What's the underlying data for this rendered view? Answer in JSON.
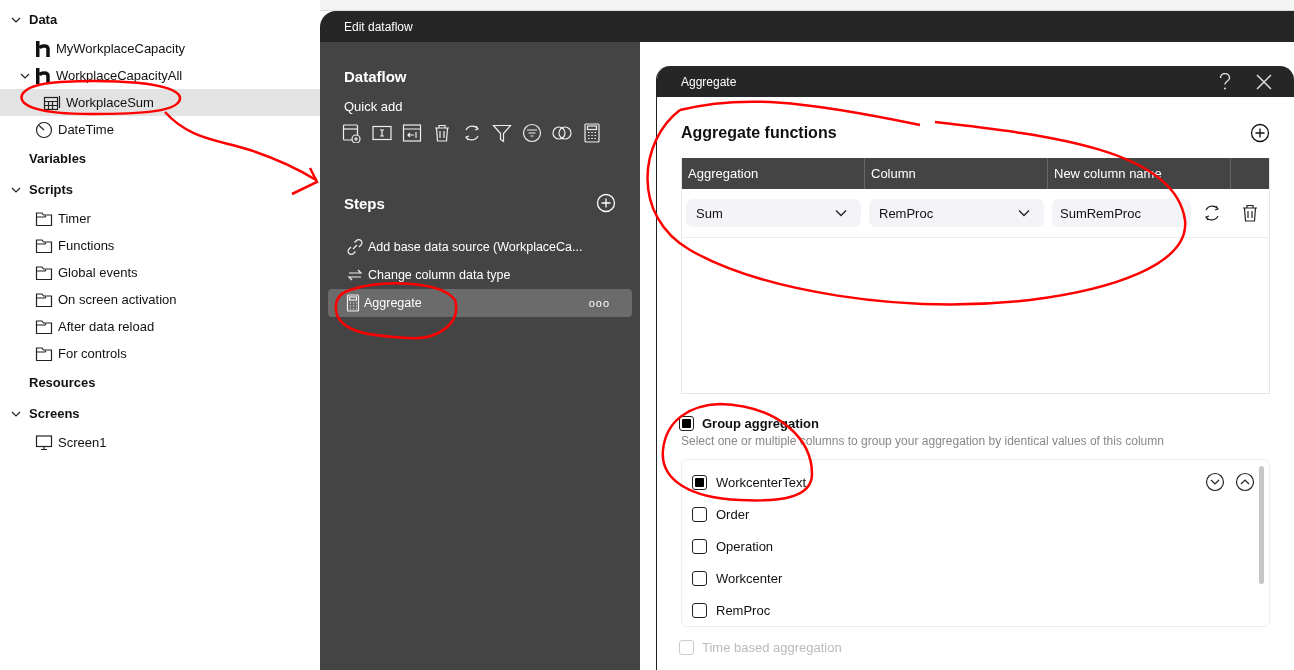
{
  "tree": [
    {
      "label": "Data",
      "expanded": true,
      "children": [
        {
          "label": "MyWorkplaceCapacity",
          "kind": "source",
          "selected": false
        },
        {
          "label": "WorkplaceCapacityAll",
          "kind": "source",
          "selected": false,
          "expanded": true,
          "children": [
            {
              "label": "WorkplaceSum",
              "kind": "table",
              "selected": true
            }
          ]
        },
        {
          "label": "DateTime",
          "kind": "clock",
          "selected": false
        }
      ]
    },
    {
      "label": "Variables"
    },
    {
      "label": "Scripts",
      "expanded": true,
      "children": [
        {
          "label": "Timer",
          "kind": "folder",
          "selected": false
        },
        {
          "label": "Functions",
          "kind": "folder",
          "selected": false
        },
        {
          "label": "Global events",
          "kind": "folder",
          "selected": false
        },
        {
          "label": "On screen activation",
          "kind": "folder",
          "selected": false
        },
        {
          "label": "After data reload",
          "kind": "folder",
          "selected": false
        },
        {
          "label": "For controls",
          "kind": "folder",
          "selected": false
        }
      ]
    },
    {
      "label": "Resources"
    },
    {
      "label": "Screens",
      "expanded": true,
      "children": [
        {
          "label": "Screen1",
          "kind": "screen",
          "selected": false
        }
      ]
    }
  ],
  "dialog": {
    "title": "Edit dataflow",
    "dataflow": {
      "heading": "Dataflow",
      "quick_add_label": "Quick add",
      "steps_heading": "Steps",
      "steps": [
        {
          "label": "Add base data source (WorkplaceCa...",
          "kind": "link",
          "selected": false
        },
        {
          "label": "Change column data type",
          "kind": "convert",
          "selected": false
        },
        {
          "label": "Aggregate",
          "kind": "calculator",
          "selected": true,
          "menu": "ooo"
        }
      ]
    }
  },
  "aggregate": {
    "title": "Aggregate",
    "functions_heading": "Aggregate functions",
    "table": {
      "columns": [
        "Aggregation",
        "Column",
        "New column name"
      ],
      "rows": [
        {
          "aggregation": "Sum",
          "column": "RemProc",
          "new_column_name": "SumRemProc"
        }
      ]
    },
    "group_aggregation": {
      "label": "Group aggregation",
      "checked": true,
      "description": "Select one or multiple columns to group your aggregation by identical values of this column",
      "columns": [
        {
          "label": "WorkcenterText",
          "checked": true
        },
        {
          "label": "Order",
          "checked": false
        },
        {
          "label": "Operation",
          "checked": false
        },
        {
          "label": "Workcenter",
          "checked": false
        },
        {
          "label": "RemProc",
          "checked": false
        }
      ]
    },
    "time_based": {
      "label": "Time based aggregation",
      "checked": false,
      "disabled": true
    }
  }
}
